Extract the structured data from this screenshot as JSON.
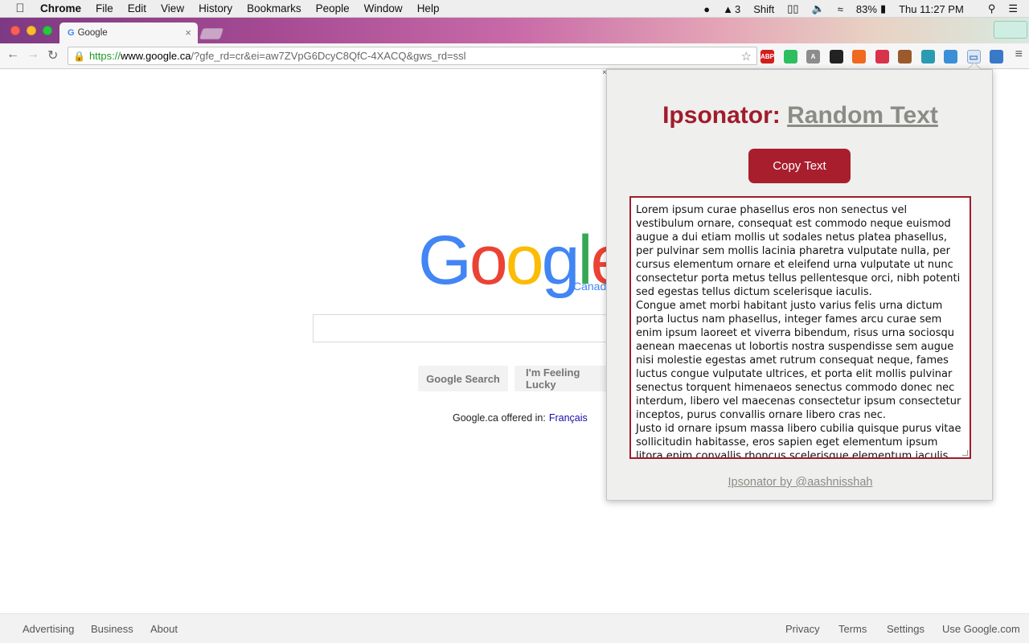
{
  "menubar": {
    "app": "Chrome",
    "items": [
      "File",
      "Edit",
      "View",
      "History",
      "Bookmarks",
      "People",
      "Window",
      "Help"
    ],
    "status": {
      "adobe_count": "3",
      "keyboard": "Shift",
      "battery": "83%",
      "clock": "Thu 11:27 PM"
    }
  },
  "tab": {
    "title": "Google"
  },
  "omnibox": {
    "scheme": "https://",
    "host": "www.google.ca",
    "path": "/?gfe_rd=cr&ei=aw7ZVpG6DcyC8QfC-4XACQ&gws_rd=ssl"
  },
  "extensions": [
    {
      "name": "adblock-plus-icon",
      "label": "ABP",
      "color": "#d41d1d"
    },
    {
      "name": "evernote-icon",
      "label": "",
      "color": "#2dbe60"
    },
    {
      "name": "angular-icon",
      "label": "A",
      "color": "#8c8c8c"
    },
    {
      "name": "ninja-icon",
      "label": "",
      "color": "#222222"
    },
    {
      "name": "fire-icon",
      "label": "",
      "color": "#ef6a1e"
    },
    {
      "name": "megaphone-icon",
      "label": "",
      "color": "#d8334a"
    },
    {
      "name": "pangolin-icon",
      "label": "",
      "color": "#9a5a2c"
    },
    {
      "name": "map-icon",
      "label": "",
      "color": "#2a9bb1"
    },
    {
      "name": "chart-icon",
      "label": "",
      "color": "#3a8fd6"
    },
    {
      "name": "ipsonator-icon",
      "label": "",
      "color": "#4a7fc1"
    },
    {
      "name": "weather-icon",
      "label": "",
      "color": "#3a78c9"
    }
  ],
  "google": {
    "logo_letters": [
      "G",
      "o",
      "o",
      "g",
      "l",
      "e"
    ],
    "sub": "Canad",
    "search_button": "Google Search",
    "lucky_button": "I'm Feeling Lucky",
    "offered_text": "Google.ca offered in:",
    "offered_lang": "Français"
  },
  "footer": {
    "left": [
      "Advertising",
      "Business",
      "About"
    ],
    "right": [
      "Privacy",
      "Terms",
      "Settings",
      "Use Google.com"
    ]
  },
  "popup": {
    "title_brand": "Ipsonator:",
    "title_link": "Random Text",
    "copy_button": "Copy Text",
    "paragraphs": [
      "Lorem ipsum curae phasellus eros non senectus vel vestibulum ornare, consequat est commodo neque euismod augue a dui etiam mollis ut sodales netus platea phasellus, per pulvinar sem mollis lacinia pharetra vulputate nulla, per cursus elementum ornare et eleifend urna vulputate ut nunc consectetur porta metus tellus pellentesque orci, nibh potenti sed egestas tellus dictum scelerisque iaculis.",
      "Congue amet morbi habitant justo varius felis urna dictum porta luctus nam phasellus, integer fames arcu curae sem enim ipsum laoreet et viverra bibendum, risus urna sociosqu aenean maecenas ut lobortis nostra suspendisse sem augue nisi molestie egestas amet rutrum consequat neque, fames luctus congue vulputate ultrices, et porta elit mollis pulvinar senectus torquent himenaeos senectus commodo donec nec interdum, libero vel maecenas consectetur ipsum consectetur inceptos, purus convallis ornare libero cras nec.",
      "Justo id ornare ipsum massa libero cubilia quisque purus vitae sollicitudin habitasse, eros sapien eget elementum ipsum litora enim convallis rhoncus scelerisque elementum iaculis, ut rutrum"
    ],
    "footer_link": "Ipsonator by @aashnisshah"
  }
}
